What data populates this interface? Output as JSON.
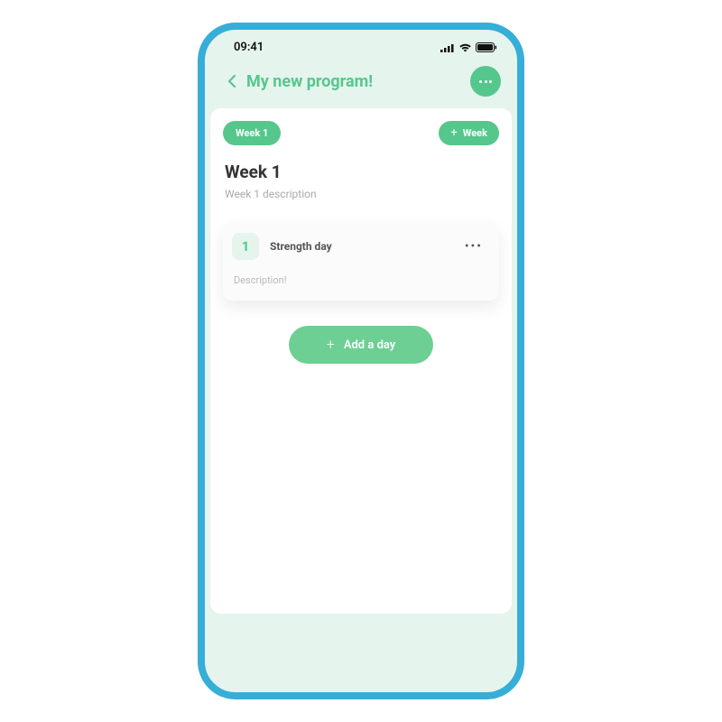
{
  "status": {
    "time": "09:41"
  },
  "header": {
    "title": "My new program!"
  },
  "weekControls": {
    "currentWeekLabel": "Week 1",
    "addWeekLabel": "Week"
  },
  "section": {
    "title": "Week 1",
    "subtitle": "Week 1 description"
  },
  "day": {
    "number": "1",
    "title": "Strength day",
    "description": "Description!"
  },
  "addDay": {
    "label": "Add a day"
  }
}
